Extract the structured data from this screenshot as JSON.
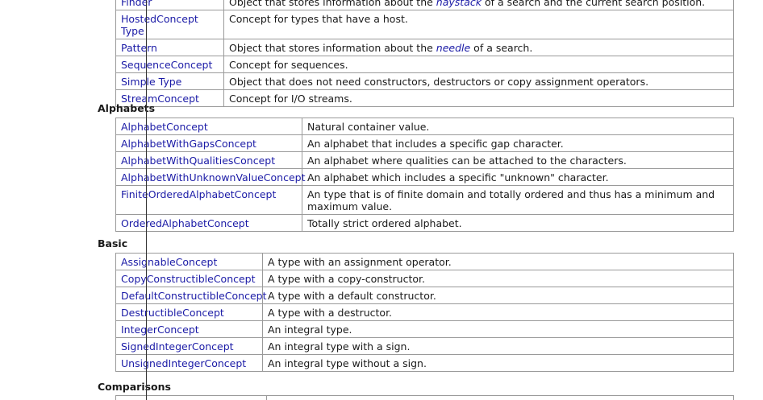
{
  "top_table": {
    "rows": [
      {
        "name": "Finder",
        "desc_pre": "Object that stores information about the ",
        "desc_em": "haystack",
        "desc_post": " of a search and the current search position."
      },
      {
        "name": "HostedConcept Type",
        "desc_pre": "Concept for types that have a host.",
        "desc_em": "",
        "desc_post": ""
      },
      {
        "name": "Pattern",
        "desc_pre": "Object that stores information about the ",
        "desc_em": "needle",
        "desc_post": " of a search."
      },
      {
        "name": "SequenceConcept",
        "desc_pre": "Concept for sequences.",
        "desc_em": "",
        "desc_post": ""
      },
      {
        "name": "Simple Type",
        "desc_pre": "Object that does not need constructors, destructors or copy assignment operators.",
        "desc_em": "",
        "desc_post": ""
      },
      {
        "name": "StreamConcept",
        "desc_pre": "Concept for I/O streams.",
        "desc_em": "",
        "desc_post": ""
      }
    ]
  },
  "alphabets": {
    "heading": "Alphabets",
    "rows": [
      {
        "name": "AlphabetConcept",
        "desc": "Natural container value."
      },
      {
        "name": "AlphabetWithGapsConcept",
        "desc": "An alphabet that includes a specific gap character."
      },
      {
        "name": "AlphabetWithQualitiesConcept",
        "desc": "An alphabet where qualities can be attached to the characters."
      },
      {
        "name": "AlphabetWithUnknownValueConcept",
        "desc": "An alphabet which includes a specific \"unknown\" character."
      },
      {
        "name": "FiniteOrderedAlphabetConcept",
        "desc": "An type that is of finite domain and totally ordered and thus has a minimum and maximum value."
      },
      {
        "name": "OrderedAlphabetConcept",
        "desc": "Totally strict ordered alphabet."
      }
    ]
  },
  "basic": {
    "heading": "Basic",
    "rows": [
      {
        "name": "AssignableConcept",
        "desc": "A type with an assignment operator."
      },
      {
        "name": "CopyConstructibleConcept",
        "desc": "A type with a copy-constructor."
      },
      {
        "name": "DefaultConstructibleConcept",
        "desc": "A type with a default constructor."
      },
      {
        "name": "DestructibleConcept",
        "desc": "A type with a destructor."
      },
      {
        "name": "IntegerConcept",
        "desc": "An integral type."
      },
      {
        "name": "SignedIntegerConcept",
        "desc": "An integral type with a sign."
      },
      {
        "name": "UnsignedIntegerConcept",
        "desc": "An integral type without a sign."
      }
    ]
  },
  "comparisons": {
    "heading": "Comparisons"
  }
}
